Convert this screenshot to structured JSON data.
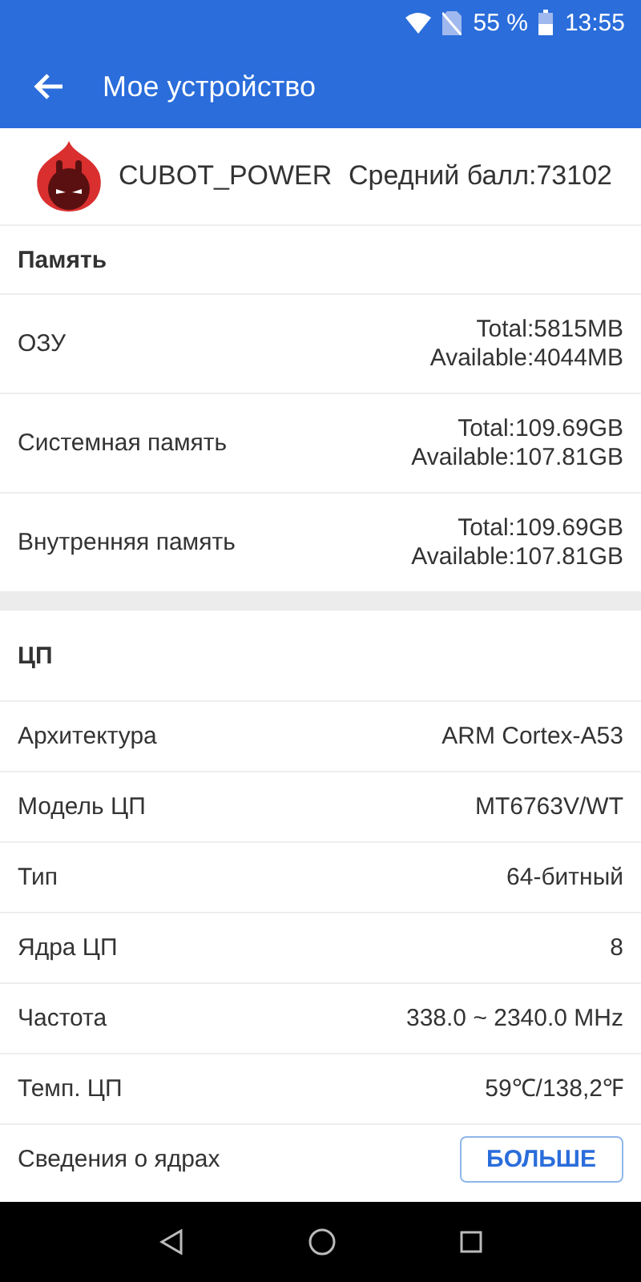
{
  "status_bar": {
    "battery": "55 %",
    "time": "13:55"
  },
  "toolbar": {
    "title": "Мое устройство"
  },
  "device": {
    "name": "CUBOT_POWER",
    "score": "Средний балл:73102"
  },
  "sections": [
    {
      "title": "Память",
      "rows": [
        {
          "label": "ОЗУ",
          "values": [
            "Total:5815MB",
            "Available:4044MB"
          ]
        },
        {
          "label": "Системная память",
          "values": [
            "Total:109.69GB",
            "Available:107.81GB"
          ]
        },
        {
          "label": "Внутренняя память",
          "values": [
            "Total:109.69GB",
            "Available:107.81GB"
          ]
        }
      ]
    },
    {
      "title": "ЦП",
      "rows": [
        {
          "label": "Архитектура",
          "values": [
            "ARM Cortex-A53"
          ]
        },
        {
          "label": "Модель ЦП",
          "values": [
            "MT6763V/WT"
          ]
        },
        {
          "label": "Тип",
          "values": [
            "64-битный"
          ]
        },
        {
          "label": "Ядра ЦП",
          "values": [
            "8"
          ]
        },
        {
          "label": "Частота",
          "values": [
            "338.0 ~ 2340.0 MHz"
          ]
        },
        {
          "label": "Темп. ЦП",
          "values": [
            "59℃/138,2℉"
          ]
        }
      ],
      "footer": {
        "label": "Сведения о ядрах",
        "button": "БОЛЬШЕ"
      }
    }
  ]
}
